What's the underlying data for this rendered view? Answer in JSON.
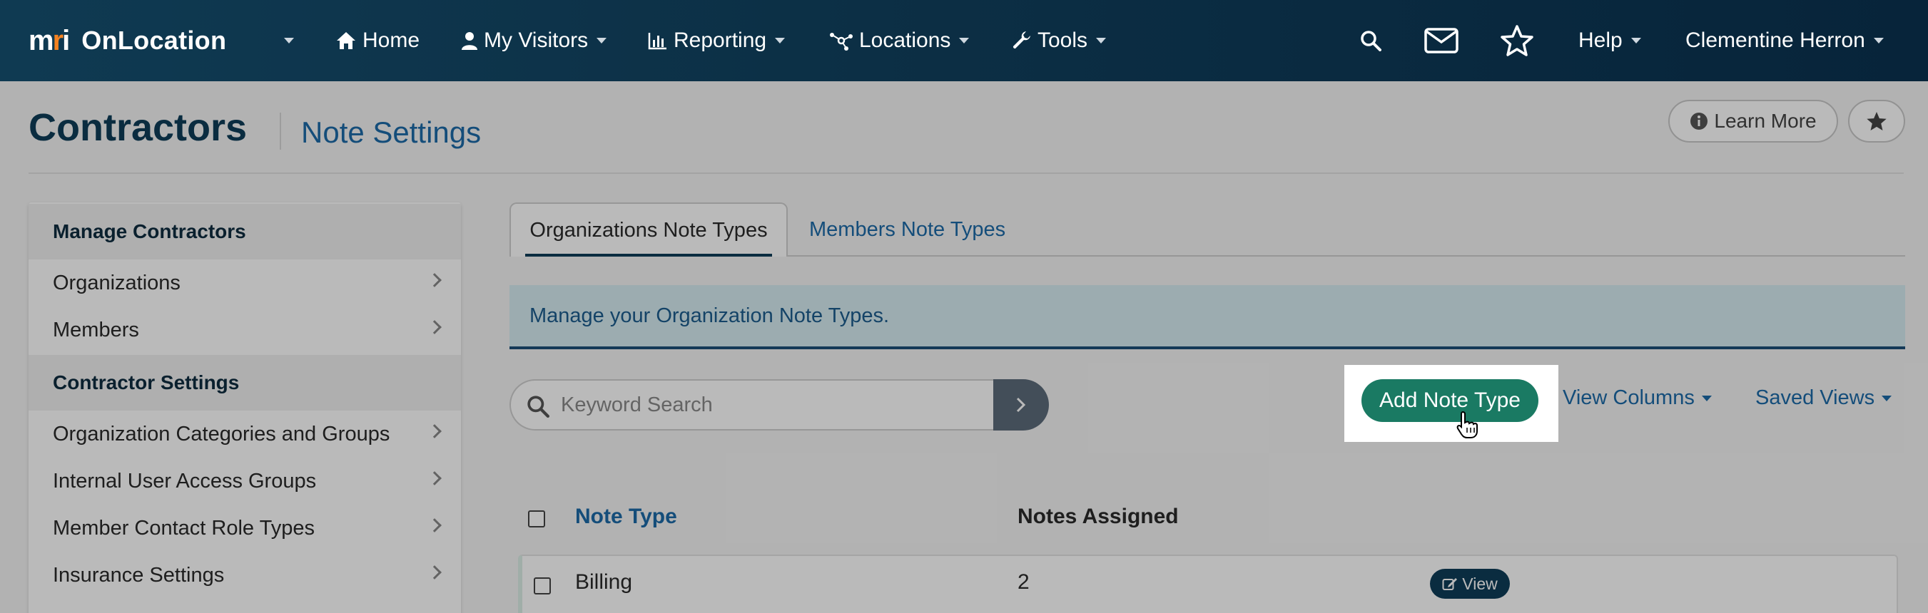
{
  "nav": {
    "brand_logo": "mri",
    "brand_name": "OnLocation",
    "items": [
      {
        "label": "Home",
        "icon": "home-icon"
      },
      {
        "label": "My Visitors",
        "icon": "user-icon"
      },
      {
        "label": "Reporting",
        "icon": "bar-chart-icon"
      },
      {
        "label": "Locations",
        "icon": "network-icon"
      },
      {
        "label": "Tools",
        "icon": "wrench-icon"
      }
    ],
    "help": "Help",
    "user": "Clementine Herron"
  },
  "header": {
    "title": "Contractors",
    "subtitle": "Note Settings",
    "learn_more": "Learn More"
  },
  "sidebar": {
    "section1": "Manage Contractors",
    "items1": [
      "Organizations",
      "Members"
    ],
    "section2": "Contractor Settings",
    "items2": [
      "Organization Categories and Groups",
      "Internal User Access Groups",
      "Member Contact Role Types",
      "Insurance Settings"
    ]
  },
  "tabs": {
    "active": "Organizations Note Types",
    "other": "Members Note Types"
  },
  "info": "Manage your Organization Note Types.",
  "toolbar": {
    "search_placeholder": "Keyword Search",
    "add_button": "Add Note Type",
    "view_columns": "View Columns",
    "saved_views": "Saved Views"
  },
  "table": {
    "headers": [
      "Note Type",
      "Notes Assigned"
    ],
    "rows": [
      {
        "note_type": "Billing",
        "notes_assigned": "2",
        "action": "View"
      }
    ]
  },
  "colors": {
    "nav_bg": "#0c2f45",
    "accent_green": "#1a7a63",
    "link_blue": "#1c6aa8",
    "title_navy": "#0e3d58"
  }
}
